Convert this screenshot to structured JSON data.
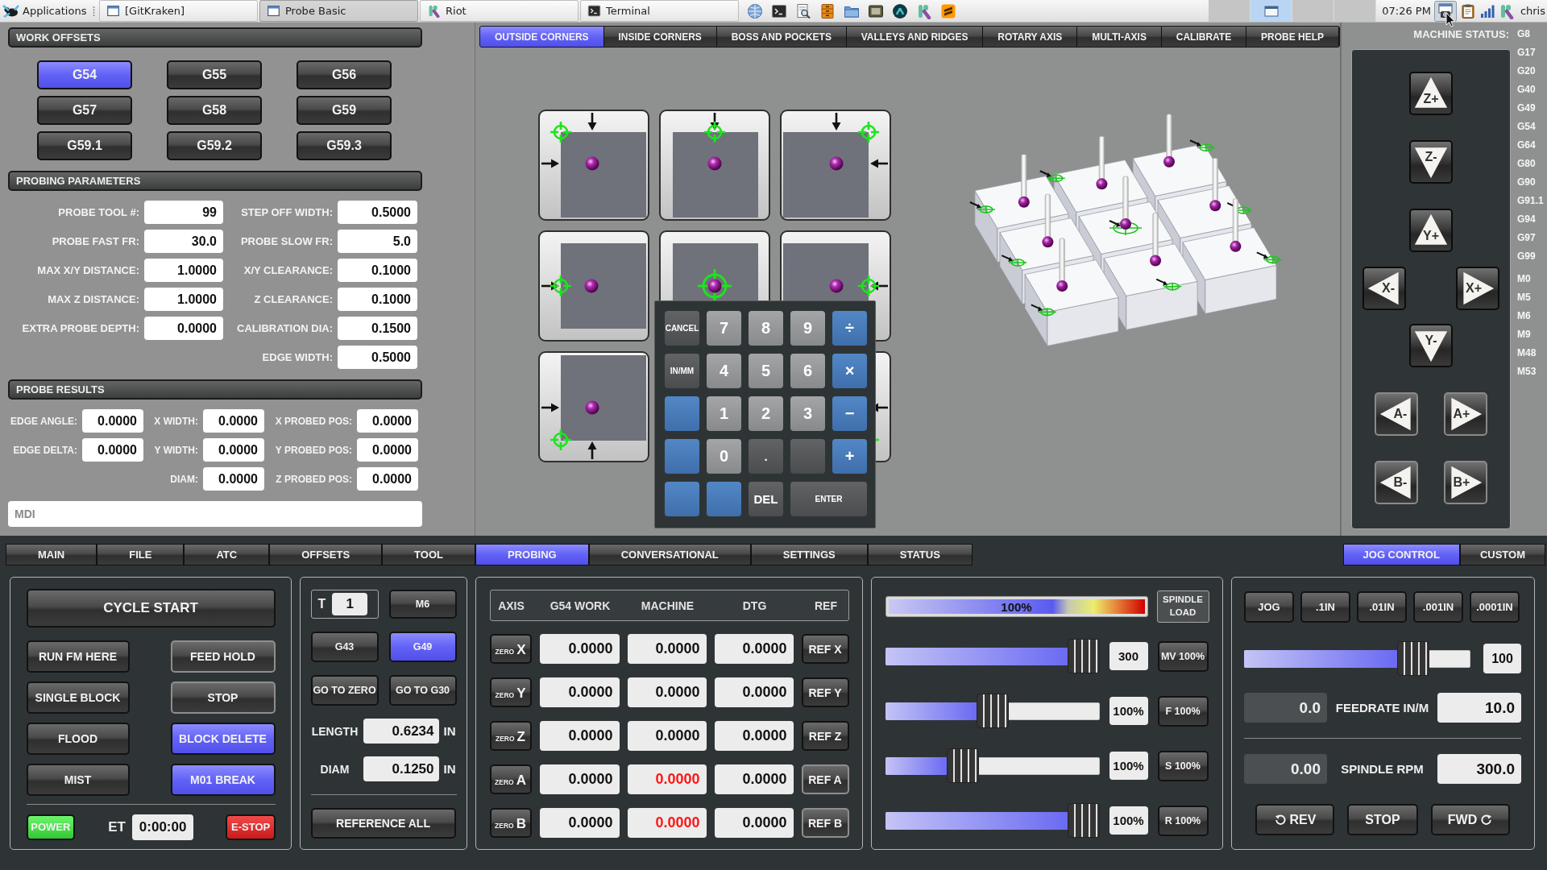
{
  "taskbar": {
    "menu": "Applications",
    "tasks": [
      {
        "label": "[GitKraken]",
        "selected": false
      },
      {
        "label": "Probe Basic",
        "selected": true
      },
      {
        "label": "Riot",
        "selected": false
      },
      {
        "label": "Terminal",
        "selected": false
      }
    ],
    "workspaces": [
      {
        "selected": false
      },
      {
        "selected": true
      },
      {
        "selected": false
      },
      {
        "selected": false
      }
    ],
    "clock": "07:26 PM",
    "user": "chris"
  },
  "work_offsets": {
    "title": "WORK OFFSETS",
    "buttons": [
      {
        "label": "G54",
        "selected": true
      },
      {
        "label": "G55",
        "selected": false
      },
      {
        "label": "G56",
        "selected": false
      },
      {
        "label": "G57",
        "selected": false
      },
      {
        "label": "G58",
        "selected": false
      },
      {
        "label": "G59",
        "selected": false
      },
      {
        "label": "G59.1",
        "selected": false
      },
      {
        "label": "G59.2",
        "selected": false
      },
      {
        "label": "G59.3",
        "selected": false
      }
    ]
  },
  "probing_parameters": {
    "title": "PROBING PARAMETERS",
    "left": [
      {
        "label": "PROBE TOOL #:",
        "value": "99"
      },
      {
        "label": "PROBE FAST FR:",
        "value": "30.0"
      },
      {
        "label": "MAX X/Y DISTANCE:",
        "value": "1.0000"
      },
      {
        "label": "MAX Z DISTANCE:",
        "value": "1.0000"
      },
      {
        "label": "EXTRA PROBE DEPTH:",
        "value": "0.0000"
      }
    ],
    "right": [
      {
        "label": "STEP OFF WIDTH:",
        "value": "0.5000"
      },
      {
        "label": "PROBE SLOW FR:",
        "value": "5.0"
      },
      {
        "label": "X/Y CLEARANCE:",
        "value": "0.1000"
      },
      {
        "label": "Z CLEARANCE:",
        "value": "0.1000"
      },
      {
        "label": "CALIBRATION DIA:",
        "value": "0.1500"
      },
      {
        "label": "EDGE WIDTH:",
        "value": "0.5000"
      }
    ]
  },
  "probe_results": {
    "title": "PROBE RESULTS",
    "columns": [
      [
        {
          "label": "EDGE ANGLE:",
          "value": "0.0000"
        },
        {
          "label": "EDGE DELTA:",
          "value": "0.0000"
        }
      ],
      [
        {
          "label": "X WIDTH:",
          "value": "0.0000"
        },
        {
          "label": "Y WIDTH:",
          "value": "0.0000"
        },
        {
          "label": "DIAM:",
          "value": "0.0000"
        }
      ],
      [
        {
          "label": "X PROBED POS:",
          "value": "0.0000"
        },
        {
          "label": "Y PROBED POS:",
          "value": "0.0000"
        },
        {
          "label": "Z PROBED POS:",
          "value": "0.0000"
        }
      ]
    ]
  },
  "mdi": {
    "placeholder": "MDI"
  },
  "probe_tabs": [
    {
      "label": "OUTSIDE CORNERS",
      "selected": true
    },
    {
      "label": "INSIDE CORNERS",
      "selected": false
    },
    {
      "label": "BOSS AND POCKETS",
      "selected": false
    },
    {
      "label": "VALLEYS AND RIDGES",
      "selected": false
    },
    {
      "label": "ROTARY AXIS",
      "selected": false
    },
    {
      "label": "MULTI-AXIS",
      "selected": false
    },
    {
      "label": "CALIBRATE",
      "selected": false
    },
    {
      "label": "PROBE HELP",
      "selected": false
    }
  ],
  "keypad": {
    "keys": [
      {
        "label": "CANCEL",
        "kind": "function"
      },
      {
        "label": "7",
        "kind": "digit"
      },
      {
        "label": "8",
        "kind": "digit"
      },
      {
        "label": "9",
        "kind": "digit"
      },
      {
        "label": "÷",
        "kind": "operator"
      },
      {
        "label": "IN/MM",
        "kind": "function"
      },
      {
        "label": "4",
        "kind": "digit"
      },
      {
        "label": "5",
        "kind": "digit"
      },
      {
        "label": "6",
        "kind": "digit"
      },
      {
        "label": "×",
        "kind": "operator"
      },
      {
        "kind": "operator"
      },
      {
        "label": "1",
        "kind": "digit"
      },
      {
        "label": "2",
        "kind": "digit"
      },
      {
        "label": "3",
        "kind": "digit"
      },
      {
        "label": "−",
        "kind": "operator"
      },
      {
        "kind": "operator"
      },
      {
        "label": "0",
        "kind": "digit"
      },
      {
        "label": ".",
        "kind": "function"
      },
      {
        "kind": "function"
      },
      {
        "label": "+",
        "kind": "operator"
      },
      {
        "kind": "operator"
      },
      {
        "kind": "operator"
      },
      {
        "label": "DEL",
        "kind": "function"
      },
      {
        "label": "ENTER",
        "kind": "enter"
      }
    ]
  },
  "machine_status": {
    "label": "MACHINE STATUS:",
    "g_codes": [
      "G8",
      "G17",
      "G20",
      "G40",
      "G49",
      "G54",
      "G64",
      "G80",
      "G90",
      "G91.1",
      "G94",
      "G97",
      "G99"
    ],
    "m_codes": [
      "M0",
      "M5",
      "M6",
      "M9",
      "M48",
      "M53"
    ]
  },
  "jog_buttons": [
    {
      "label": "Z+",
      "kind": "up",
      "disabled": false
    },
    {
      "label": "Z-",
      "kind": "down",
      "disabled": false
    },
    {
      "label": "Y+",
      "kind": "up",
      "disabled": false
    },
    {
      "label": "X-",
      "kind": "left",
      "disabled": false
    },
    {
      "label": "X+",
      "kind": "right",
      "disabled": false
    },
    {
      "label": "Y-",
      "kind": "down",
      "disabled": false
    },
    {
      "label": "A-",
      "kind": "left",
      "disabled": true
    },
    {
      "label": "A+",
      "kind": "right",
      "disabled": true
    },
    {
      "label": "B-",
      "kind": "left",
      "disabled": true
    },
    {
      "label": "B+",
      "kind": "right",
      "disabled": true
    }
  ],
  "main_tabs": [
    {
      "label": "MAIN",
      "selected": false
    },
    {
      "label": "FILE",
      "selected": false
    },
    {
      "label": "ATC",
      "selected": false
    },
    {
      "label": "OFFSETS",
      "selected": false
    },
    {
      "label": "TOOL",
      "selected": false
    },
    {
      "label": "PROBING",
      "selected": true
    },
    {
      "label": "CONVERSATIONAL",
      "selected": false
    },
    {
      "label": "SETTINGS",
      "selected": false
    },
    {
      "label": "STATUS",
      "selected": false
    }
  ],
  "side_tabs": [
    {
      "label": "JOG CONTROL",
      "selected": true
    },
    {
      "label": "CUSTOM",
      "selected": false
    }
  ],
  "program_controls": {
    "cycle_start": "CYCLE START",
    "buttons": [
      {
        "label": "RUN FM HERE",
        "on": false,
        "disabled": false
      },
      {
        "label": "FEED HOLD",
        "on": false,
        "disabled": true
      },
      {
        "label": "SINGLE BLOCK",
        "on": false,
        "disabled": false
      },
      {
        "label": "STOP",
        "on": false,
        "disabled": true
      },
      {
        "label": "FLOOD",
        "on": false,
        "disabled": false
      },
      {
        "label": "BLOCK DELETE",
        "on": true,
        "disabled": false
      },
      {
        "label": "MIST",
        "on": false,
        "disabled": false
      },
      {
        "label": "M01 BREAK",
        "on": true,
        "disabled": false
      }
    ],
    "power": {
      "label": "POWER",
      "on": true
    },
    "elapsed": {
      "label": "ET",
      "value": "0:00:00"
    },
    "estop": "E-STOP"
  },
  "tool_panel": {
    "tool_label": "T",
    "tool_number": "1",
    "change_button": "M6",
    "offset_buttons": [
      {
        "label": "G43",
        "selected": false
      },
      {
        "label": "G49",
        "selected": true
      }
    ],
    "goto_buttons": [
      "GO TO ZERO",
      "GO TO G30"
    ],
    "measurements": [
      {
        "label": "LENGTH",
        "value": "0.6234",
        "unit": "IN"
      },
      {
        "label": "DIAM",
        "value": "0.1250",
        "unit": "IN"
      }
    ],
    "reference_all": "REFERENCE ALL"
  },
  "dro": {
    "columns": [
      "AXIS",
      "G54 WORK",
      "MACHINE",
      "DTG",
      "REF"
    ],
    "rows": [
      {
        "zero": "ZERO",
        "axis": "X",
        "work": "0.0000",
        "machine": "0.0000",
        "dtg": "0.0000",
        "ref": "REF X",
        "homed": true,
        "ref_disabled": false
      },
      {
        "zero": "ZERO",
        "axis": "Y",
        "work": "0.0000",
        "machine": "0.0000",
        "dtg": "0.0000",
        "ref": "REF Y",
        "homed": true,
        "ref_disabled": false
      },
      {
        "zero": "ZERO",
        "axis": "Z",
        "work": "0.0000",
        "machine": "0.0000",
        "dtg": "0.0000",
        "ref": "REF Z",
        "homed": true,
        "ref_disabled": false
      },
      {
        "zero": "ZERO",
        "axis": "A",
        "work": "0.0000",
        "machine": "0.0000",
        "dtg": "0.0000",
        "ref": "REF A",
        "homed": false,
        "ref_disabled": true
      },
      {
        "zero": "ZERO",
        "axis": "B",
        "work": "0.0000",
        "machine": "0.0000",
        "dtg": "0.0000",
        "ref": "REF B",
        "homed": false,
        "ref_disabled": true
      }
    ]
  },
  "overrides": {
    "spindle_load": {
      "level": 1,
      "reading": "100%",
      "label": "SPINDLE LOAD"
    },
    "sliders": [
      {
        "level": 1,
        "value": "300",
        "button": "MV 100%"
      },
      {
        "level": 0.5,
        "value": "100%",
        "button": "F 100%"
      },
      {
        "level": 0.34,
        "value": "100%",
        "button": "S 100%"
      },
      {
        "level": 1,
        "value": "100%",
        "button": "R 100%"
      }
    ]
  },
  "jog_control": {
    "increments": [
      {
        "label": "JOG",
        "selected": false
      },
      {
        "label": ".1IN",
        "selected": false
      },
      {
        "label": ".01IN",
        "selected": false
      },
      {
        "label": ".001IN",
        "selected": false
      },
      {
        "label": ".0001IN",
        "selected": false
      }
    ],
    "slider": {
      "level": 0.79,
      "value": "100"
    },
    "rows": [
      {
        "current": "0.0",
        "label": "FEEDRATE IN/M",
        "setting": "10.0"
      },
      {
        "current": "0.00",
        "label": "SPINDLE RPM",
        "setting": "300.0"
      }
    ],
    "spindle_buttons": [
      {
        "label": "REV",
        "kind": "reverse"
      },
      {
        "label": "STOP",
        "kind": "stop"
      },
      {
        "label": "FWD",
        "kind": "forward"
      }
    ]
  }
}
